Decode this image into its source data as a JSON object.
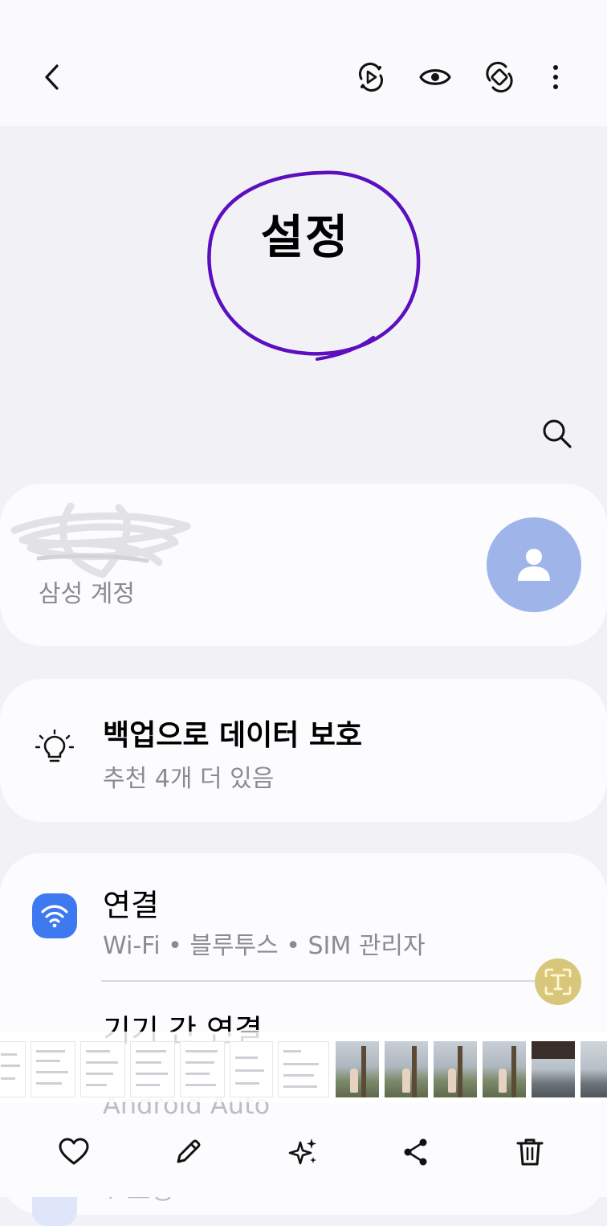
{
  "header": {
    "back_icon": "chevron-left-icon",
    "actions": [
      "motion-play-icon",
      "eye-icon",
      "rotate-icon",
      "more-vert-icon"
    ]
  },
  "page": {
    "title": "설정",
    "annotation_color": "#5b0fbf"
  },
  "account": {
    "label": "삼성 계정",
    "avatar_color": "#9fb5ea"
  },
  "backup": {
    "title": "백업으로 데이터 보호",
    "subtitle": "추천 4개 더 있음"
  },
  "connections": {
    "title": "연결",
    "subtitle": "Wi-Fi  •  블루투스  •  SIM 관리자",
    "accent": "#3e79f0",
    "next_title": "기기 간 연결",
    "ghost_item_1": "Android Auto",
    "ghost_item_2": "T 로밍"
  },
  "toolbar": {
    "items": [
      "heart-icon",
      "pencil-icon",
      "sparkle-icon",
      "share-icon",
      "trash-icon"
    ]
  }
}
